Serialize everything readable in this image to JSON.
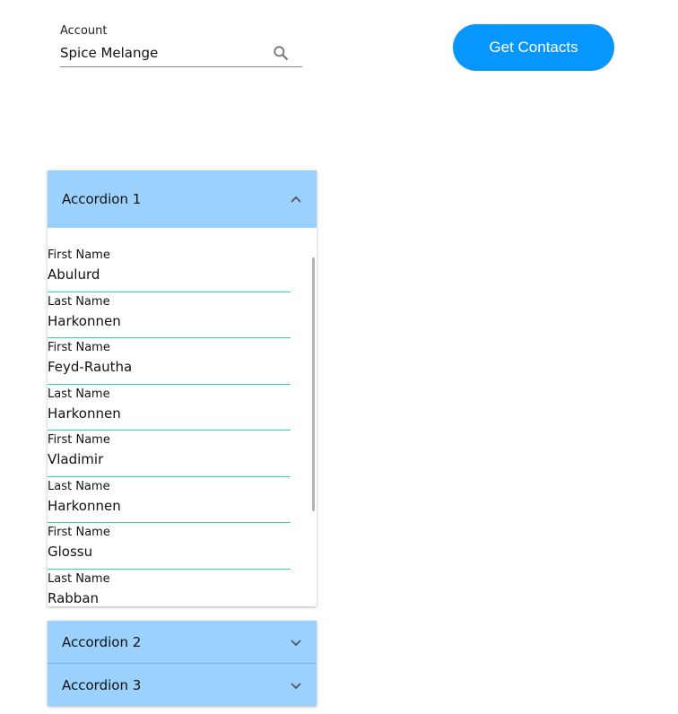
{
  "account": {
    "label": "Account",
    "value": "Spice Melange"
  },
  "button": {
    "label": "Get Contacts"
  },
  "accordions": [
    {
      "title": "Accordion 1",
      "expanded": true,
      "fields": [
        {
          "label": "First Name",
          "value": "Abulurd"
        },
        {
          "label": "Last Name",
          "value": "Harkonnen"
        },
        {
          "label": "First Name",
          "value": "Feyd-Rautha"
        },
        {
          "label": "Last Name",
          "value": "Harkonnen"
        },
        {
          "label": "First Name",
          "value": "Vladimir"
        },
        {
          "label": "Last Name",
          "value": "Harkonnen"
        },
        {
          "label": "First Name",
          "value": "Glossu"
        },
        {
          "label": "Last Name",
          "value": "Rabban"
        }
      ]
    },
    {
      "title": "Accordion 2",
      "expanded": false
    },
    {
      "title": "Accordion 3",
      "expanded": false
    }
  ],
  "colors": {
    "accent": "#0796fd",
    "header": "#9bd1fd",
    "underline": "#2ed898"
  }
}
